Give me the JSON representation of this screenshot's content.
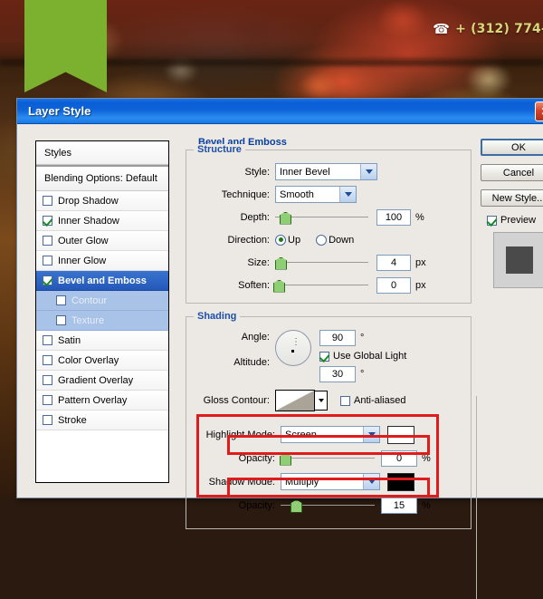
{
  "background": {
    "phone_number": "+ (312) 774-",
    "phone_icon": "phone-icon",
    "ribbon_color": "#7bb12e",
    "phone_text_color": "#d8d77a"
  },
  "dialog": {
    "title": "Layer Style",
    "close_label": "✕",
    "titlebar_color": "#0e63d8"
  },
  "styles_panel": {
    "header": "Styles",
    "blending_options": "Blending Options: Default",
    "items": [
      {
        "label": "Drop Shadow",
        "checked": false,
        "selected": false,
        "sub": false
      },
      {
        "label": "Inner Shadow",
        "checked": true,
        "selected": false,
        "sub": false
      },
      {
        "label": "Outer Glow",
        "checked": false,
        "selected": false,
        "sub": false
      },
      {
        "label": "Inner Glow",
        "checked": false,
        "selected": false,
        "sub": false
      },
      {
        "label": "Bevel and Emboss",
        "checked": true,
        "selected": true,
        "sub": false
      },
      {
        "label": "Contour",
        "checked": false,
        "selected": false,
        "sub": true
      },
      {
        "label": "Texture",
        "checked": false,
        "selected": false,
        "sub": true
      },
      {
        "label": "Satin",
        "checked": false,
        "selected": false,
        "sub": false
      },
      {
        "label": "Color Overlay",
        "checked": false,
        "selected": false,
        "sub": false
      },
      {
        "label": "Gradient Overlay",
        "checked": false,
        "selected": false,
        "sub": false
      },
      {
        "label": "Pattern Overlay",
        "checked": false,
        "selected": false,
        "sub": false
      },
      {
        "label": "Stroke",
        "checked": false,
        "selected": false,
        "sub": false
      }
    ]
  },
  "panel": {
    "title": "Bevel and Emboss",
    "structure": {
      "legend": "Structure",
      "style_label": "Style:",
      "style_value": "Inner Bevel",
      "technique_label": "Technique:",
      "technique_value": "Smooth",
      "depth_label": "Depth:",
      "depth_value": "100",
      "depth_unit": "%",
      "direction_label": "Direction:",
      "direction_up": "Up",
      "direction_down": "Down",
      "direction_selected": "Up",
      "size_label": "Size:",
      "size_value": "4",
      "size_unit": "px",
      "soften_label": "Soften:",
      "soften_value": "0",
      "soften_unit": "px"
    },
    "shading": {
      "legend": "Shading",
      "angle_label": "Angle:",
      "angle_value": "90",
      "angle_unit": "°",
      "use_global_light": "Use Global Light",
      "use_global_light_checked": true,
      "altitude_label": "Altitude:",
      "altitude_value": "30",
      "altitude_unit": "°",
      "gloss_contour_label": "Gloss Contour:",
      "anti_aliased": "Anti-aliased",
      "anti_aliased_checked": false,
      "highlight_mode_label": "Highlight Mode:",
      "highlight_mode_value": "Screen",
      "highlight_color": "#ffffff",
      "highlight_opacity_label": "Opacity:",
      "highlight_opacity_value": "0",
      "highlight_opacity_unit": "%",
      "shadow_mode_label": "Shadow Mode:",
      "shadow_mode_value": "Multiply",
      "shadow_color": "#000000",
      "shadow_opacity_label": "Opacity:",
      "shadow_opacity_value": "15",
      "shadow_opacity_unit": "%"
    }
  },
  "buttons": {
    "ok": "OK",
    "cancel": "Cancel",
    "new_style": "New Style...",
    "preview_label": "Preview",
    "preview_checked": true
  },
  "annotations": {
    "highlight_color": "#e01b1b",
    "boxes": 3
  }
}
